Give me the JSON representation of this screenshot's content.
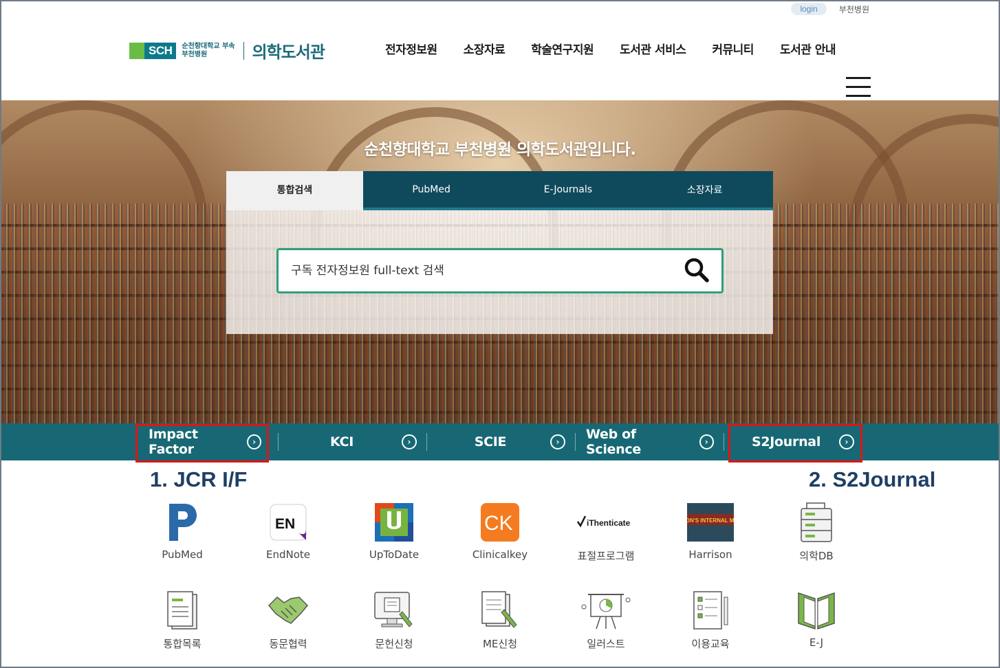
{
  "header": {
    "login_label": "login",
    "hospital_link": "부천병원",
    "logo": {
      "mark": "SCH",
      "sub_line1": "순천향대학교 부속",
      "sub_line2": "부천병원",
      "title": "의학도서관"
    },
    "nav": [
      "전자정보원",
      "소장자료",
      "학술연구지원",
      "도서관 서비스",
      "커뮤니티",
      "도서관 안내"
    ]
  },
  "hero": {
    "title": "순천향대학교 부천병원 의학도서관입니다.",
    "tabs": [
      "통합검색",
      "PubMed",
      "E-Journals",
      "소장자료"
    ],
    "active_tab": 0,
    "search_placeholder": "구독 전자정보원 full-text 검색"
  },
  "quickbar": [
    "Impact Factor",
    "KCI",
    "SCIE",
    "Web of Science",
    "S2Journal"
  ],
  "annotations": {
    "left": "1. JCR I/F",
    "right": "2. S2Journal"
  },
  "quicklinks": [
    {
      "label": "PubMed",
      "icon": "pubmed-icon"
    },
    {
      "label": "EndNote",
      "icon": "endnote-icon"
    },
    {
      "label": "UpToDate",
      "icon": "uptodate-icon"
    },
    {
      "label": "Clinicalkey",
      "icon": "clinicalkey-icon"
    },
    {
      "label": "표절프로그램",
      "icon": "ithenticate-icon",
      "logo_text": "iThenticate"
    },
    {
      "label": "Harrison",
      "icon": "harrison-icon",
      "logo_text": "HARRISON'S INTERNAL MEDICINE"
    },
    {
      "label": "의학DB",
      "icon": "database-icon"
    },
    {
      "label": "통합목록",
      "icon": "catalog-icon"
    },
    {
      "label": "동문협력",
      "icon": "handshake-icon"
    },
    {
      "label": "문헌신청",
      "icon": "document-request-icon"
    },
    {
      "label": "ME신청",
      "icon": "me-request-icon"
    },
    {
      "label": "일러스트",
      "icon": "illustration-icon"
    },
    {
      "label": "이용교육",
      "icon": "education-icon"
    },
    {
      "label": "E-J",
      "icon": "ejournal-book-icon"
    }
  ],
  "colors": {
    "teal": "#0e6e80",
    "dark_teal": "#0f4a5c",
    "green": "#69bd45",
    "highlight": "#e01515",
    "annotation": "#1f3f64"
  }
}
